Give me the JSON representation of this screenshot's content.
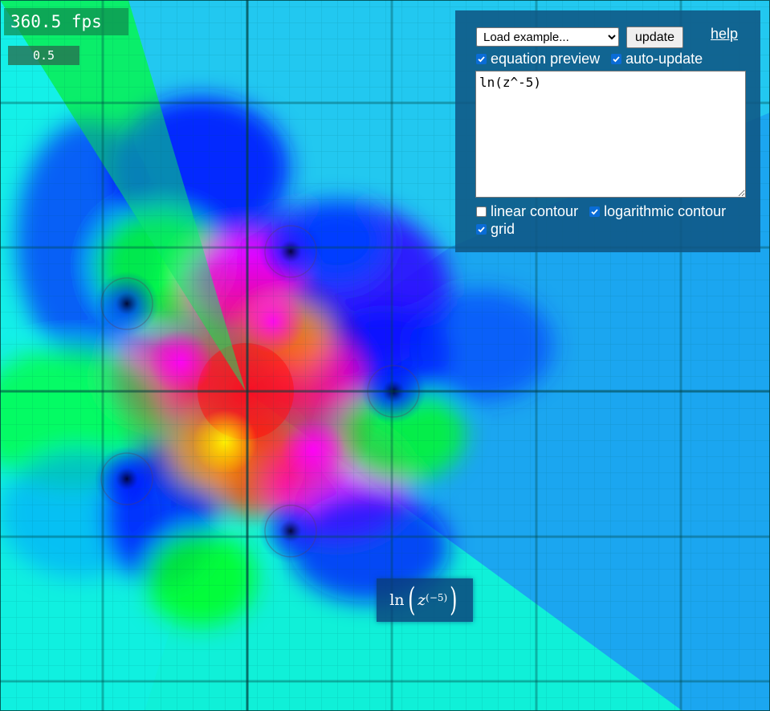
{
  "overlay": {
    "fps_text": "360.5 fps",
    "param_value": "0.5"
  },
  "panel": {
    "example_select": {
      "selected": "Load example..."
    },
    "update_label": "update",
    "help_label": "help",
    "equation_preview": {
      "label": "equation preview",
      "checked": true
    },
    "auto_update": {
      "label": "auto-update",
      "checked": true
    },
    "equation_text": "ln(z^-5)",
    "linear_contour": {
      "label": "linear contour",
      "checked": false
    },
    "logarithmic_contour": {
      "label": "logarithmic contour",
      "checked": true
    },
    "grid": {
      "label": "grid",
      "checked": true
    }
  },
  "preview": {
    "fn": "ln",
    "var": "z",
    "exponent": "(−5)"
  },
  "colors": {
    "panel_bg": "#0f5582",
    "checkbox_accent": "#0a6cd6",
    "plot_green": "#00ff40",
    "plot_cyan": "#00ffff",
    "plot_blue": "#0010ff",
    "plot_magenta": "#ff00ff",
    "plot_red": "#ff0000",
    "plot_yellow": "#ffff00"
  }
}
